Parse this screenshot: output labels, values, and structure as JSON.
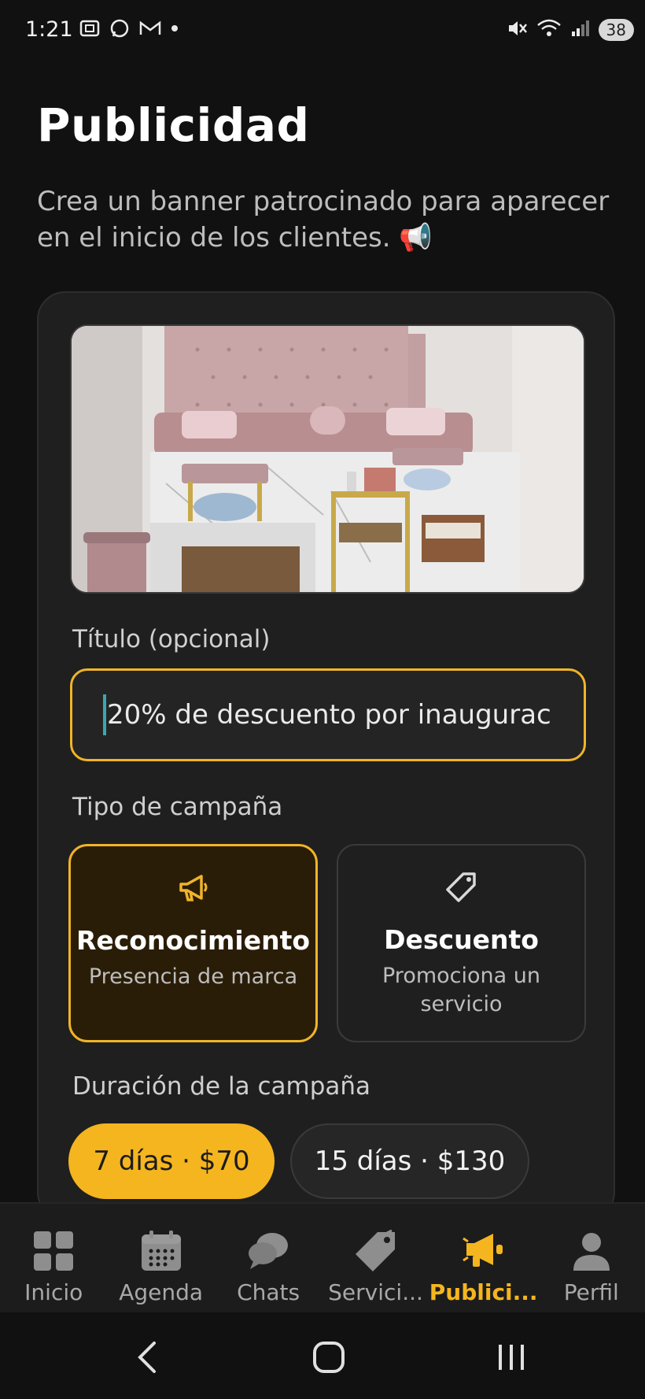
{
  "status_bar": {
    "time": "1:21",
    "battery": "38",
    "left_icons": [
      "screenshot-icon",
      "whatsapp-icon",
      "gmail-icon",
      "dot-icon"
    ],
    "right_icons": [
      "mute-icon",
      "wifi-icon",
      "signal-icon",
      "battery-icon"
    ]
  },
  "header": {
    "title": "Publicidad",
    "subtitle": "Crea un banner patrocinado para aparecer en el inicio de los clientes. 📢"
  },
  "form": {
    "title_label": "Título (opcional)",
    "title_value": "20% de descuento por inaugurac",
    "type_label": "Tipo de campaña",
    "campaign_types": [
      {
        "title": "Reconocimiento",
        "desc": "Presencia de marca",
        "icon": "megaphone-icon",
        "selected": true
      },
      {
        "title": "Descuento",
        "desc": "Promociona un servicio",
        "icon": "tag-icon",
        "selected": false
      }
    ],
    "duration_label": "Duración de la campaña",
    "durations": [
      {
        "label": "7 días · $70",
        "selected": true
      },
      {
        "label": "15 días · $130",
        "selected": false
      }
    ]
  },
  "bottom_nav": [
    {
      "label": "Inicio",
      "icon": "grid-icon"
    },
    {
      "label": "Agenda",
      "icon": "calendar-icon"
    },
    {
      "label": "Chats",
      "icon": "chat-icon"
    },
    {
      "label": "Servici...",
      "icon": "tag-icon"
    },
    {
      "label": "Publici...",
      "icon": "megaphone-icon",
      "active": true
    },
    {
      "label": "Perfil",
      "icon": "person-icon"
    }
  ],
  "colors": {
    "accent": "#f5b51f",
    "background": "#111111",
    "card": "#1f1f1f"
  }
}
